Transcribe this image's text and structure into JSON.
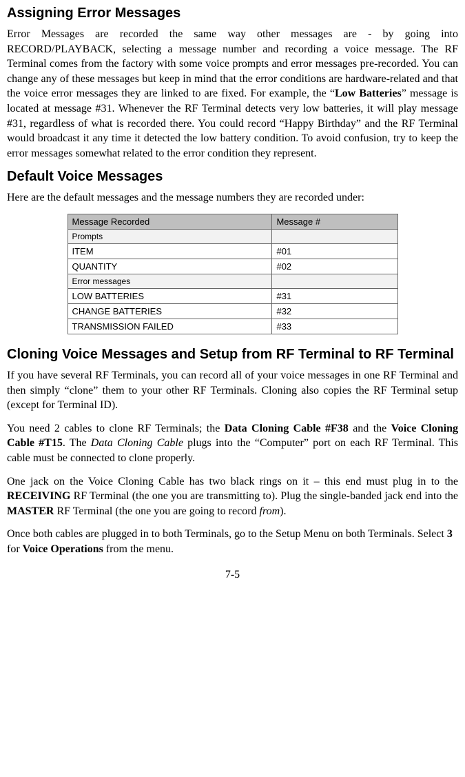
{
  "h1": "Assigning Error Messages",
  "p1_a": "Error Messages are recorded the same way other messages are - by going into RECORD/PLAYBACK, selecting a message number and recording a voice message.  The RF Terminal comes from the factory with some voice prompts and error messages pre-recorded. You can change any of these messages but keep in mind that the error conditions are hardware-related and that the voice error messages they are linked to are fixed. For example, the “",
  "p1_bold": "Low Batteries",
  "p1_b": "” message is located at message #31. Whenever the RF Terminal detects very low batteries, it will play message #31, regardless of what is recorded there. You could record “Happy Birthday” and the RF Terminal would broadcast it any time it detected the low battery condition. To avoid confusion, try to keep the error messages somewhat related to the error condition they represent.",
  "h2": "Default Voice Messages",
  "p2": "Here are the default messages and the message numbers they are recorded under:",
  "table": {
    "hdr_col1": "Message Recorded",
    "hdr_col2": "Message #",
    "sub_prompts": "Prompts",
    "rows_prompts": [
      {
        "name": "ITEM",
        "num": "#01"
      },
      {
        "name": "QUANTITY",
        "num": "#02"
      }
    ],
    "sub_errors": "Error messages",
    "rows_errors": [
      {
        "name": "LOW BATTERIES",
        "num": "#31"
      },
      {
        "name": "CHANGE BATTERIES",
        "num": "#32"
      },
      {
        "name": "TRANSMISSION FAILED",
        "num": "#33"
      }
    ]
  },
  "h3": "Cloning Voice Messages and Setup from RF Terminal to RF Terminal",
  "p3": "If you have several RF Terminals, you can record all of your voice messages in one RF Terminal and then simply “clone” them to your other RF Terminals. Cloning also copies the RF Terminal setup (except for Terminal ID).",
  "p4_a": "You need 2 cables to clone RF Terminals; the ",
  "p4_b1": "Data Cloning Cable #F38",
  "p4_b": " and the ",
  "p4_b2": "Voice Cloning Cable #T15",
  "p4_c": ". The ",
  "p4_i": "Data Cloning Cable",
  "p4_d": " plugs into the “Computer” port on each RF Terminal.  This cable must be connected to clone properly.",
  "p5_a": "One jack on the Voice Cloning Cable has two black rings on it – this end must plug in to the ",
  "p5_b1": "RECEIVING",
  "p5_b": " RF Terminal (the one you are transmitting to). Plug the single-banded jack end into the ",
  "p5_b2": "MASTER",
  "p5_c": " RF Terminal (the one you are going to record ",
  "p5_i": "from",
  "p5_d": ").",
  "p6_a": "Once both cables are plugged in to both Terminals, go to the Setup Menu on both Terminals. Select ",
  "p6_b1": "3",
  "p6_b": " for ",
  "p6_b2": "Voice Operations",
  "p6_c": " from the menu.",
  "page_num": "7-5",
  "chart_data": {
    "type": "table",
    "title": "Default Voice Messages",
    "columns": [
      "Message Recorded",
      "Message #"
    ],
    "sections": [
      {
        "header": "Prompts",
        "rows": [
          [
            "ITEM",
            "#01"
          ],
          [
            "QUANTITY",
            "#02"
          ]
        ]
      },
      {
        "header": "Error messages",
        "rows": [
          [
            "LOW BATTERIES",
            "#31"
          ],
          [
            "CHANGE BATTERIES",
            "#32"
          ],
          [
            "TRANSMISSION FAILED",
            "#33"
          ]
        ]
      }
    ]
  }
}
